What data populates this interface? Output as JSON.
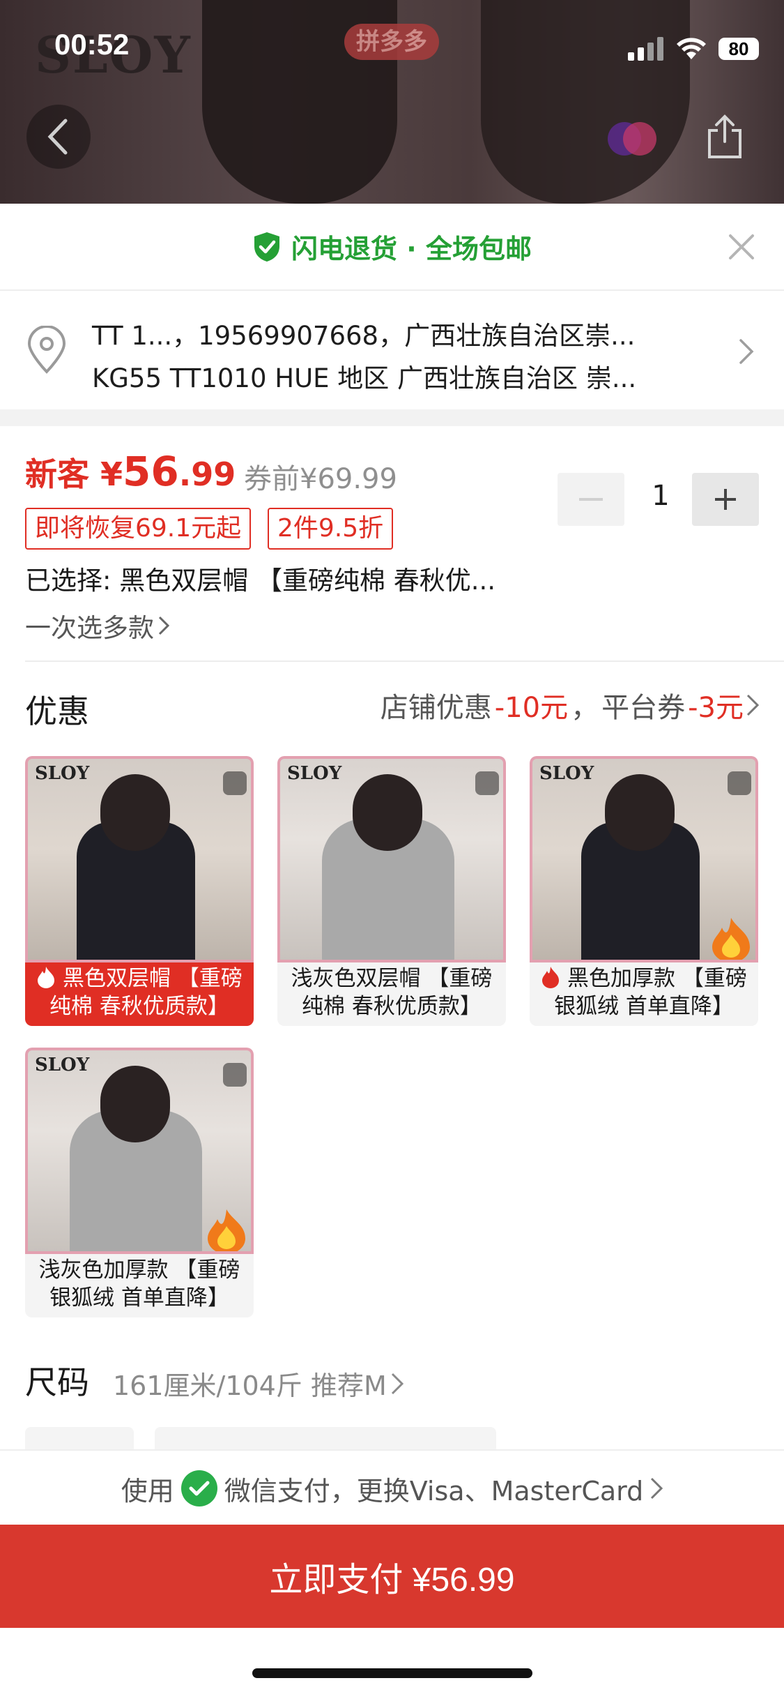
{
  "status_bar": {
    "time": "00:52",
    "battery": "80"
  },
  "hero": {
    "brand_logo": "SLOY",
    "app_badge": "拼多多"
  },
  "banner": {
    "text": "闪电退货 · 全场包邮"
  },
  "address": {
    "line1": "TT 1...，19569907668，广西壮族自治区崇...",
    "line2": "KG55 TT1010 HUE 地区 广西壮族自治区 崇..."
  },
  "price": {
    "new_prefix": "新客",
    "currency": "¥",
    "integer": "56",
    "decimal": ".99",
    "before_coupon": "券前¥69.99",
    "tags": [
      "即将恢复69.1元起",
      "2件9.5折"
    ],
    "quantity": "1"
  },
  "selection": {
    "selected_text": "已选择: 黑色双层帽 【重磅纯棉 春秋优...",
    "multi_select": "一次选多款"
  },
  "promotions": {
    "title": "优惠",
    "shop_label": "店铺优惠",
    "shop_value": "-10元",
    "separator": "，",
    "platform_label": "平台券",
    "platform_value": "-3元"
  },
  "variants": [
    {
      "caption": "黑色双层帽 【重磅纯棉 春秋优质款】",
      "color": "dark",
      "selected": true,
      "hot": true,
      "logo": "SLOY"
    },
    {
      "caption": "浅灰色双层帽 【重磅纯棉 春秋优质款】",
      "color": "light",
      "selected": false,
      "hot": false,
      "logo": "SLOY"
    },
    {
      "caption": "黑色加厚款 【重磅银狐绒 首单直降】",
      "color": "dark",
      "selected": false,
      "hot": true,
      "logo": "SLOY"
    },
    {
      "caption": "浅灰色加厚款 【重磅银狐绒 首单直降】",
      "color": "light",
      "selected": false,
      "hot": false,
      "logo": "SLOY"
    }
  ],
  "size": {
    "title": "尺码",
    "hint": "161厘米/104斤 推荐M"
  },
  "payment": {
    "prefix": "使用",
    "method": "微信支付，更换Visa、MasterCard",
    "pay_button": "立即支付 ¥56.99"
  },
  "colors": {
    "accent_red": "#e02e24",
    "pay_red": "#d8382e",
    "green": "#25a035"
  }
}
